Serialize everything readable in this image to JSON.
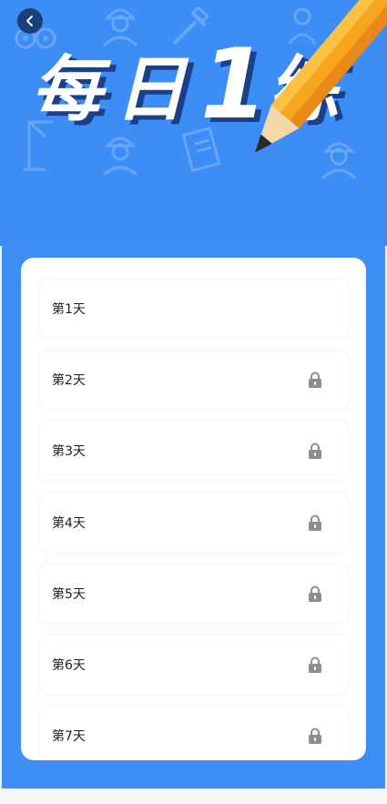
{
  "header": {
    "title_chars": [
      "每",
      "日",
      "1",
      "练"
    ],
    "back_icon": "chevron-left-icon"
  },
  "days": [
    {
      "label": "第1天",
      "locked": false
    },
    {
      "label": "第2天",
      "locked": true
    },
    {
      "label": "第3天",
      "locked": true
    },
    {
      "label": "第4天",
      "locked": true
    },
    {
      "label": "第5天",
      "locked": true
    },
    {
      "label": "第6天",
      "locked": true
    },
    {
      "label": "第7天",
      "locked": true
    }
  ],
  "colors": {
    "background": "#3c8df5",
    "card": "#ffffff",
    "lock": "#8e8e8e",
    "title_text": "#ffffff",
    "title_shadow": "#1c3f8a",
    "pencil_body": "#f7a51c"
  }
}
